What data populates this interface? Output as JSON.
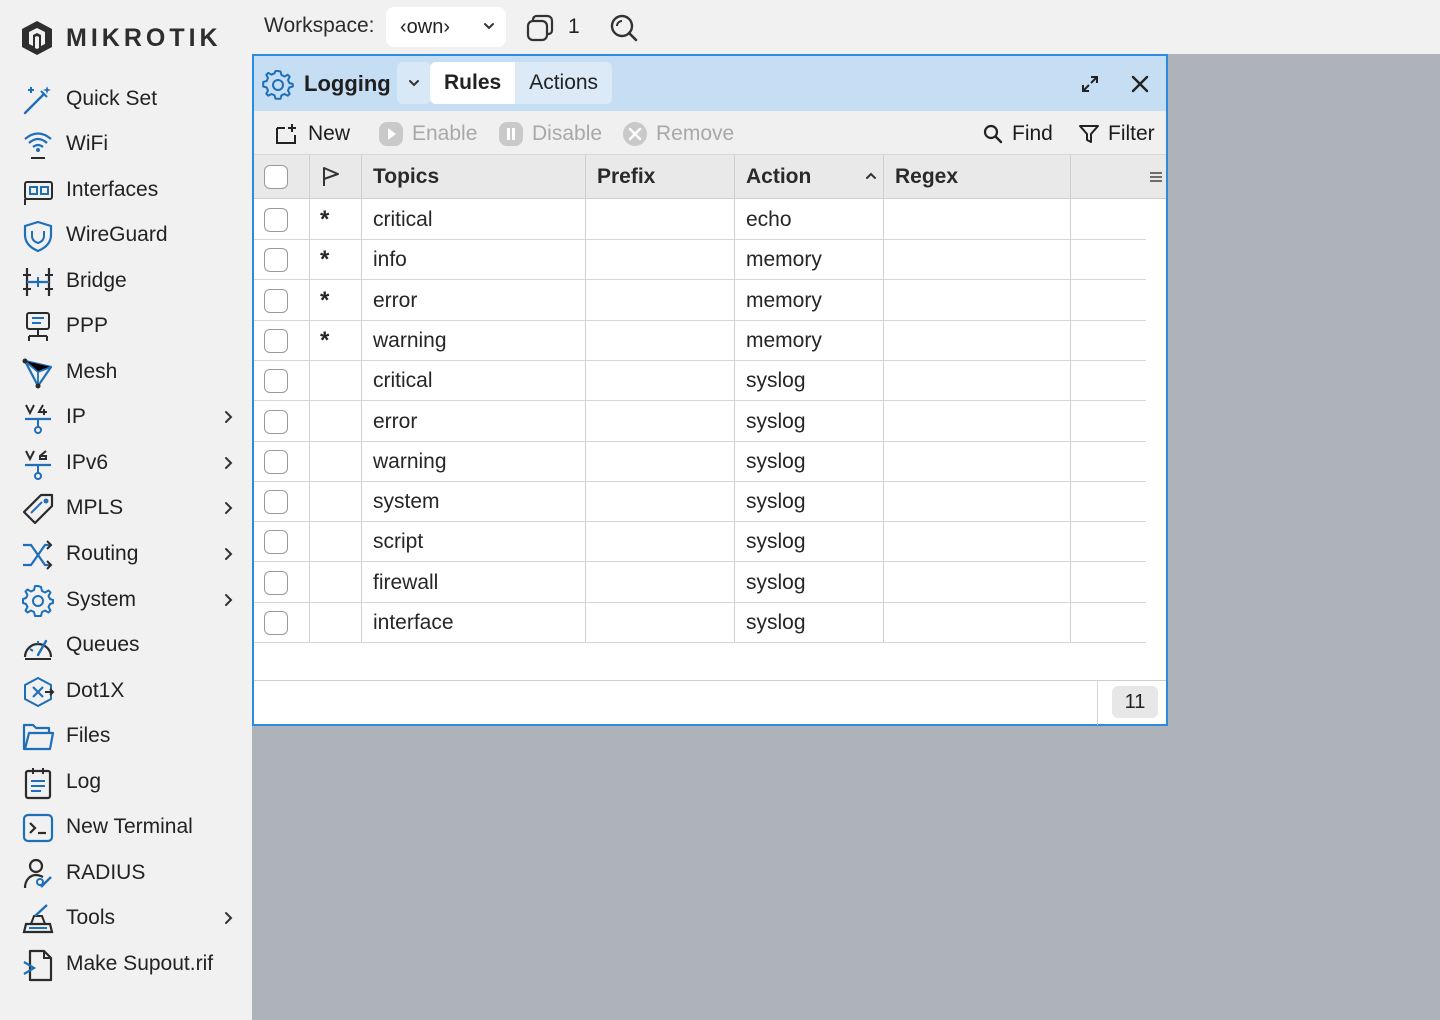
{
  "brand": {
    "logo_text": "MIKROTIK"
  },
  "sidebar": {
    "items": [
      {
        "label": "Quick Set",
        "icon": "wand-icon",
        "submenu": false
      },
      {
        "label": "WiFi",
        "icon": "wifi-icon",
        "submenu": false
      },
      {
        "label": "Interfaces",
        "icon": "interfaces-icon",
        "submenu": false
      },
      {
        "label": "WireGuard",
        "icon": "shield-icon",
        "submenu": false
      },
      {
        "label": "Bridge",
        "icon": "bridge-icon",
        "submenu": false
      },
      {
        "label": "PPP",
        "icon": "ppp-icon",
        "submenu": false
      },
      {
        "label": "Mesh",
        "icon": "mesh-icon",
        "submenu": false
      },
      {
        "label": "IP",
        "icon": "ipv4-icon",
        "submenu": true
      },
      {
        "label": "IPv6",
        "icon": "ipv6-icon",
        "submenu": true
      },
      {
        "label": "MPLS",
        "icon": "tag-icon",
        "submenu": true
      },
      {
        "label": "Routing",
        "icon": "routing-icon",
        "submenu": true
      },
      {
        "label": "System",
        "icon": "gear-icon",
        "submenu": true
      },
      {
        "label": "Queues",
        "icon": "gauge-icon",
        "submenu": false
      },
      {
        "label": "Dot1X",
        "icon": "dot1x-icon",
        "submenu": false
      },
      {
        "label": "Files",
        "icon": "folder-icon",
        "submenu": false
      },
      {
        "label": "Log",
        "icon": "log-icon",
        "submenu": false
      },
      {
        "label": "New Terminal",
        "icon": "terminal-icon",
        "submenu": false
      },
      {
        "label": "RADIUS",
        "icon": "radius-icon",
        "submenu": false
      },
      {
        "label": "Tools",
        "icon": "tools-icon",
        "submenu": true
      },
      {
        "label": "Make Supout.rif",
        "icon": "supout-icon",
        "submenu": false
      }
    ]
  },
  "topbar": {
    "workspace_label": "Workspace:",
    "workspace_value": "‹own›",
    "window_count": "1"
  },
  "window": {
    "title": "Logging",
    "tabs": [
      {
        "label": "Rules",
        "active": true
      },
      {
        "label": "Actions",
        "active": false
      }
    ],
    "toolbar": {
      "new_label": "New",
      "enable_label": "Enable",
      "disable_label": "Disable",
      "remove_label": "Remove",
      "find_label": "Find",
      "filter_label": "Filter"
    },
    "columns": {
      "topics": "Topics",
      "prefix": "Prefix",
      "action": "Action",
      "regex": "Regex"
    },
    "rows": [
      {
        "flag": "*",
        "topics": "critical",
        "prefix": "",
        "action": "echo",
        "regex": ""
      },
      {
        "flag": "*",
        "topics": "info",
        "prefix": "",
        "action": "memory",
        "regex": ""
      },
      {
        "flag": "*",
        "topics": "error",
        "prefix": "",
        "action": "memory",
        "regex": ""
      },
      {
        "flag": "*",
        "topics": "warning",
        "prefix": "",
        "action": "memory",
        "regex": ""
      },
      {
        "flag": "",
        "topics": "critical",
        "prefix": "",
        "action": "syslog",
        "regex": ""
      },
      {
        "flag": "",
        "topics": "error",
        "prefix": "",
        "action": "syslog",
        "regex": ""
      },
      {
        "flag": "",
        "topics": "warning",
        "prefix": "",
        "action": "syslog",
        "regex": ""
      },
      {
        "flag": "",
        "topics": "system",
        "prefix": "",
        "action": "syslog",
        "regex": ""
      },
      {
        "flag": "",
        "topics": "script",
        "prefix": "",
        "action": "syslog",
        "regex": ""
      },
      {
        "flag": "",
        "topics": "firewall",
        "prefix": "",
        "action": "syslog",
        "regex": ""
      },
      {
        "flag": "",
        "topics": "interface",
        "prefix": "",
        "action": "syslog",
        "regex": ""
      }
    ],
    "row_count": "11"
  },
  "colors": {
    "accent": "#2a8be0",
    "window_header": "#c6def3",
    "icon_blue": "#1f6fb8"
  }
}
